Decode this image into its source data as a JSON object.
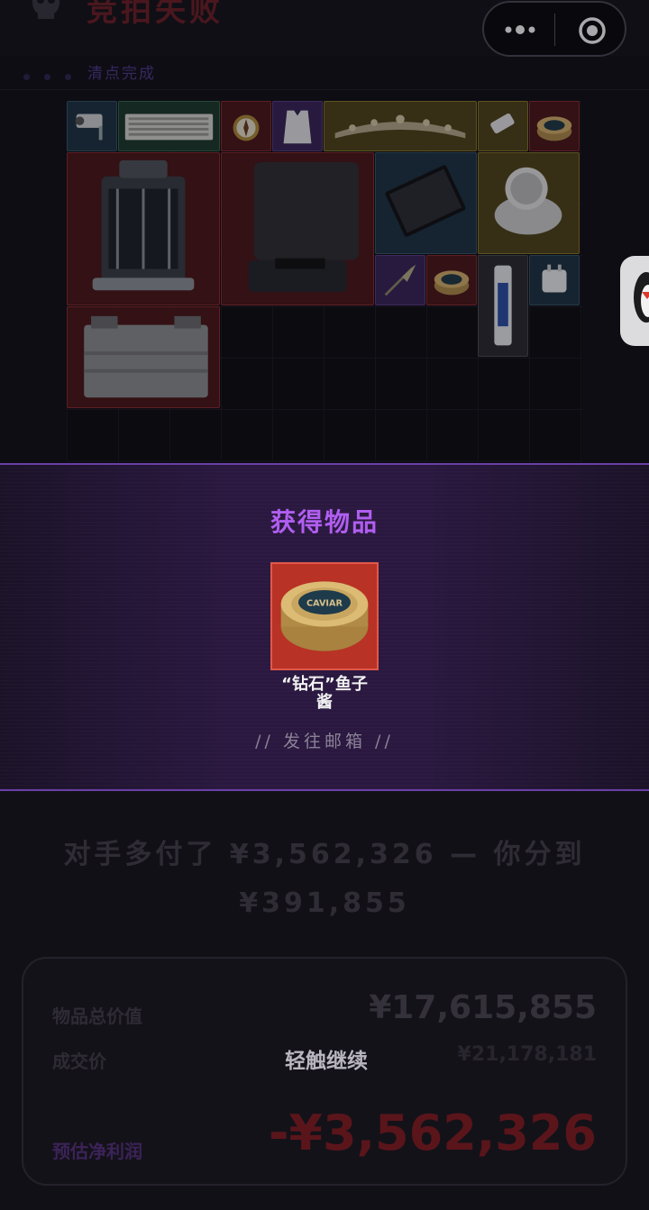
{
  "header": {
    "title": "竞拍失败",
    "subtitle": "清点完成"
  },
  "colors": {
    "accent_purple": "#b05ef0",
    "fail_red": "#6e1f27",
    "rarity_red": "#b83226"
  },
  "inventory": {
    "items": [
      {
        "name": "camera",
        "rarity": "blue",
        "icon": "security-camera-icon"
      },
      {
        "name": "keyboard",
        "rarity": "green",
        "icon": "keyboard-icon"
      },
      {
        "name": "compass",
        "rarity": "red",
        "icon": "compass-icon"
      },
      {
        "name": "vest",
        "rarity": "purple",
        "icon": "vest-icon"
      },
      {
        "name": "tiara",
        "rarity": "gold",
        "icon": "tiara-icon"
      },
      {
        "name": "usb-drive",
        "rarity": "gold",
        "icon": "usb-drive-icon"
      },
      {
        "name": "caviar-small",
        "rarity": "red",
        "icon": "caviar-icon"
      },
      {
        "name": "reactor",
        "rarity": "red",
        "icon": "reactor-icon"
      },
      {
        "name": "robot-vacuum",
        "rarity": "red",
        "icon": "robot-vacuum-icon"
      },
      {
        "name": "tablet",
        "rarity": "blue",
        "icon": "tablet-icon"
      },
      {
        "name": "device",
        "rarity": "gold",
        "icon": "device-icon"
      },
      {
        "name": "spearhead",
        "rarity": "purple",
        "icon": "spearhead-icon"
      },
      {
        "name": "caviar-small-2",
        "rarity": "red",
        "icon": "caviar-icon"
      },
      {
        "name": "tube",
        "rarity": "gray",
        "icon": "tube-icon"
      },
      {
        "name": "adapter",
        "rarity": "blue",
        "icon": "adapter-icon"
      },
      {
        "name": "battery",
        "rarity": "red",
        "icon": "battery-icon"
      }
    ]
  },
  "obtained": {
    "title": "获得物品",
    "item_name_line1": "“钻石”鱼子",
    "item_name_line2": "酱",
    "mailbox_text": "// 发往邮箱 //"
  },
  "summary": {
    "line1": "对手多付了 ¥3,562,326 — 你分到",
    "line2": "¥391,855"
  },
  "price_card": {
    "total_label": "物品总价值",
    "total_value": "¥17,615,855",
    "deal_label": "成交价",
    "deal_value": "¥21,178,181",
    "tap_continue": "轻触继续",
    "profit_label": "预估净利润",
    "profit_value": "-¥3,562,326"
  }
}
